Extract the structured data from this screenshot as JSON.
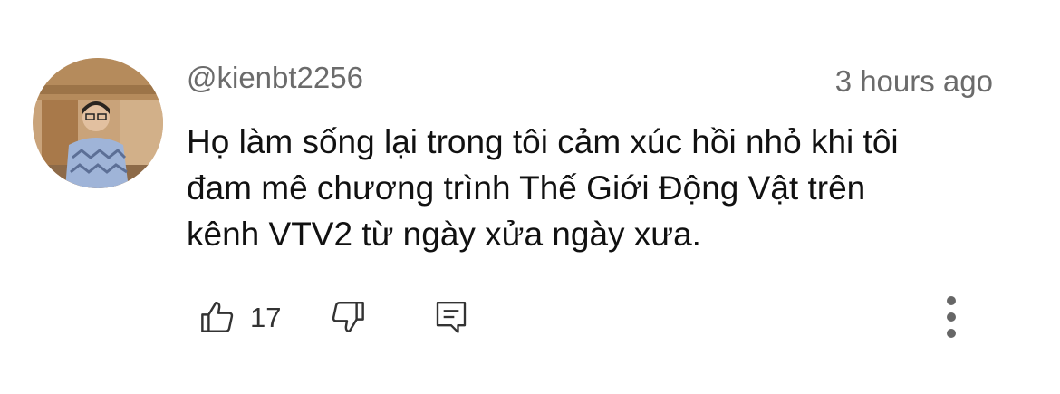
{
  "comment": {
    "author_handle": "@kienbt2256",
    "timestamp": "3 hours ago",
    "body_lines": [
      "Họ làm sống lại trong tôi cảm xúc hồi nhỏ khi tôi",
      "đam mê chương trình Thế Giới Động Vật trên",
      "kênh VTV2 từ ngày xửa ngày xưa."
    ],
    "like_count": "17"
  },
  "icons": {
    "like": "thumbs-up-icon",
    "dislike": "thumbs-down-icon",
    "reply": "reply-comment-icon",
    "more": "more-vertical-icon"
  },
  "colors": {
    "text_primary": "#111111",
    "text_secondary": "#6b6b6b",
    "icon": "#333333",
    "background": "#ffffff"
  }
}
